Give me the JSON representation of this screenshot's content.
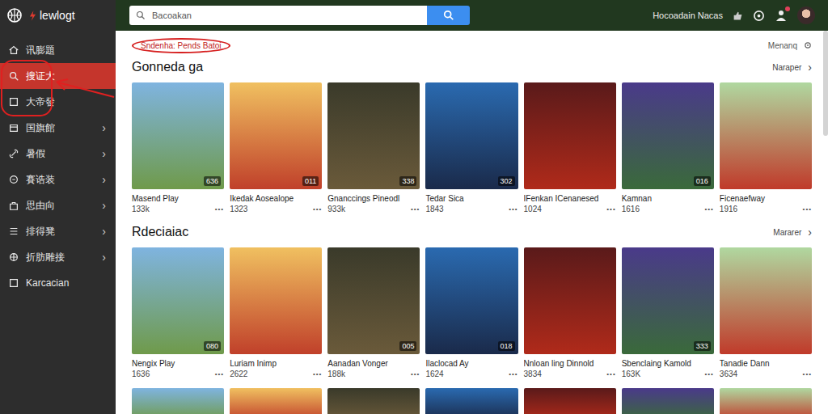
{
  "app": {
    "logo": "lewlogt"
  },
  "search": {
    "placeholder": "Bacoakan"
  },
  "header": {
    "user_label": "Hocoadain Nacas"
  },
  "sidebar": {
    "items": [
      {
        "label": "讯膨題",
        "selected": false,
        "expandable": false
      },
      {
        "label": "搜证大",
        "selected": true,
        "expandable": false
      },
      {
        "label": "大帝發",
        "selected": false,
        "expandable": false
      },
      {
        "label": "国旗館",
        "selected": false,
        "expandable": true
      },
      {
        "label": "暑假",
        "selected": false,
        "expandable": true
      },
      {
        "label": "賽诰装",
        "selected": false,
        "expandable": true
      },
      {
        "label": "思由向",
        "selected": false,
        "expandable": true
      },
      {
        "label": "排得凳",
        "selected": false,
        "expandable": true
      },
      {
        "label": "折肪雕接",
        "selected": false,
        "expandable": true
      },
      {
        "label": "Karcacian",
        "selected": false,
        "expandable": false
      }
    ],
    "chevron": "›"
  },
  "filter_label": "Sndenha: Pends Batoi",
  "manage": "Menanq",
  "sections": [
    {
      "title": "Gonneda ga",
      "more": "Naraper",
      "more_icon": "›",
      "menu_glyph": "•••",
      "games": [
        {
          "title": "Masend Play",
          "count": "133k",
          "badge": "636"
        },
        {
          "title": "Ikedak Aosealope",
          "count": "1323",
          "badge": "011"
        },
        {
          "title": "Gnanccings Pineodl",
          "count": "933k",
          "badge": "338"
        },
        {
          "title": "Tedar Sica",
          "count": "1843",
          "badge": "302"
        },
        {
          "title": "IFenkan ICenanesed",
          "count": "1024",
          "badge": ""
        },
        {
          "title": "Kamnan",
          "count": "1616",
          "badge": "016"
        },
        {
          "title": "Ficenaefway",
          "count": "1916",
          "badge": ""
        }
      ]
    },
    {
      "title": "Rdeciaiac",
      "more": "Mararer",
      "more_icon": "›",
      "menu_glyph": "•••",
      "games": [
        {
          "title": "Nengix Play",
          "count": "1636",
          "badge": "080"
        },
        {
          "title": "Luriam Inimp",
          "count": "2622",
          "badge": ""
        },
        {
          "title": "Aanadan Vonger",
          "count": "188k",
          "badge": "005"
        },
        {
          "title": "Ilaclocad Ay",
          "count": "1624",
          "badge": "018"
        },
        {
          "title": "Nnloan ling Dinnold",
          "count": "3834",
          "badge": ""
        },
        {
          "title": "Sbenclaing Kamold",
          "count": "163K",
          "badge": "333"
        },
        {
          "title": "Tanadie Dann",
          "count": "3634",
          "badge": ""
        }
      ]
    }
  ]
}
